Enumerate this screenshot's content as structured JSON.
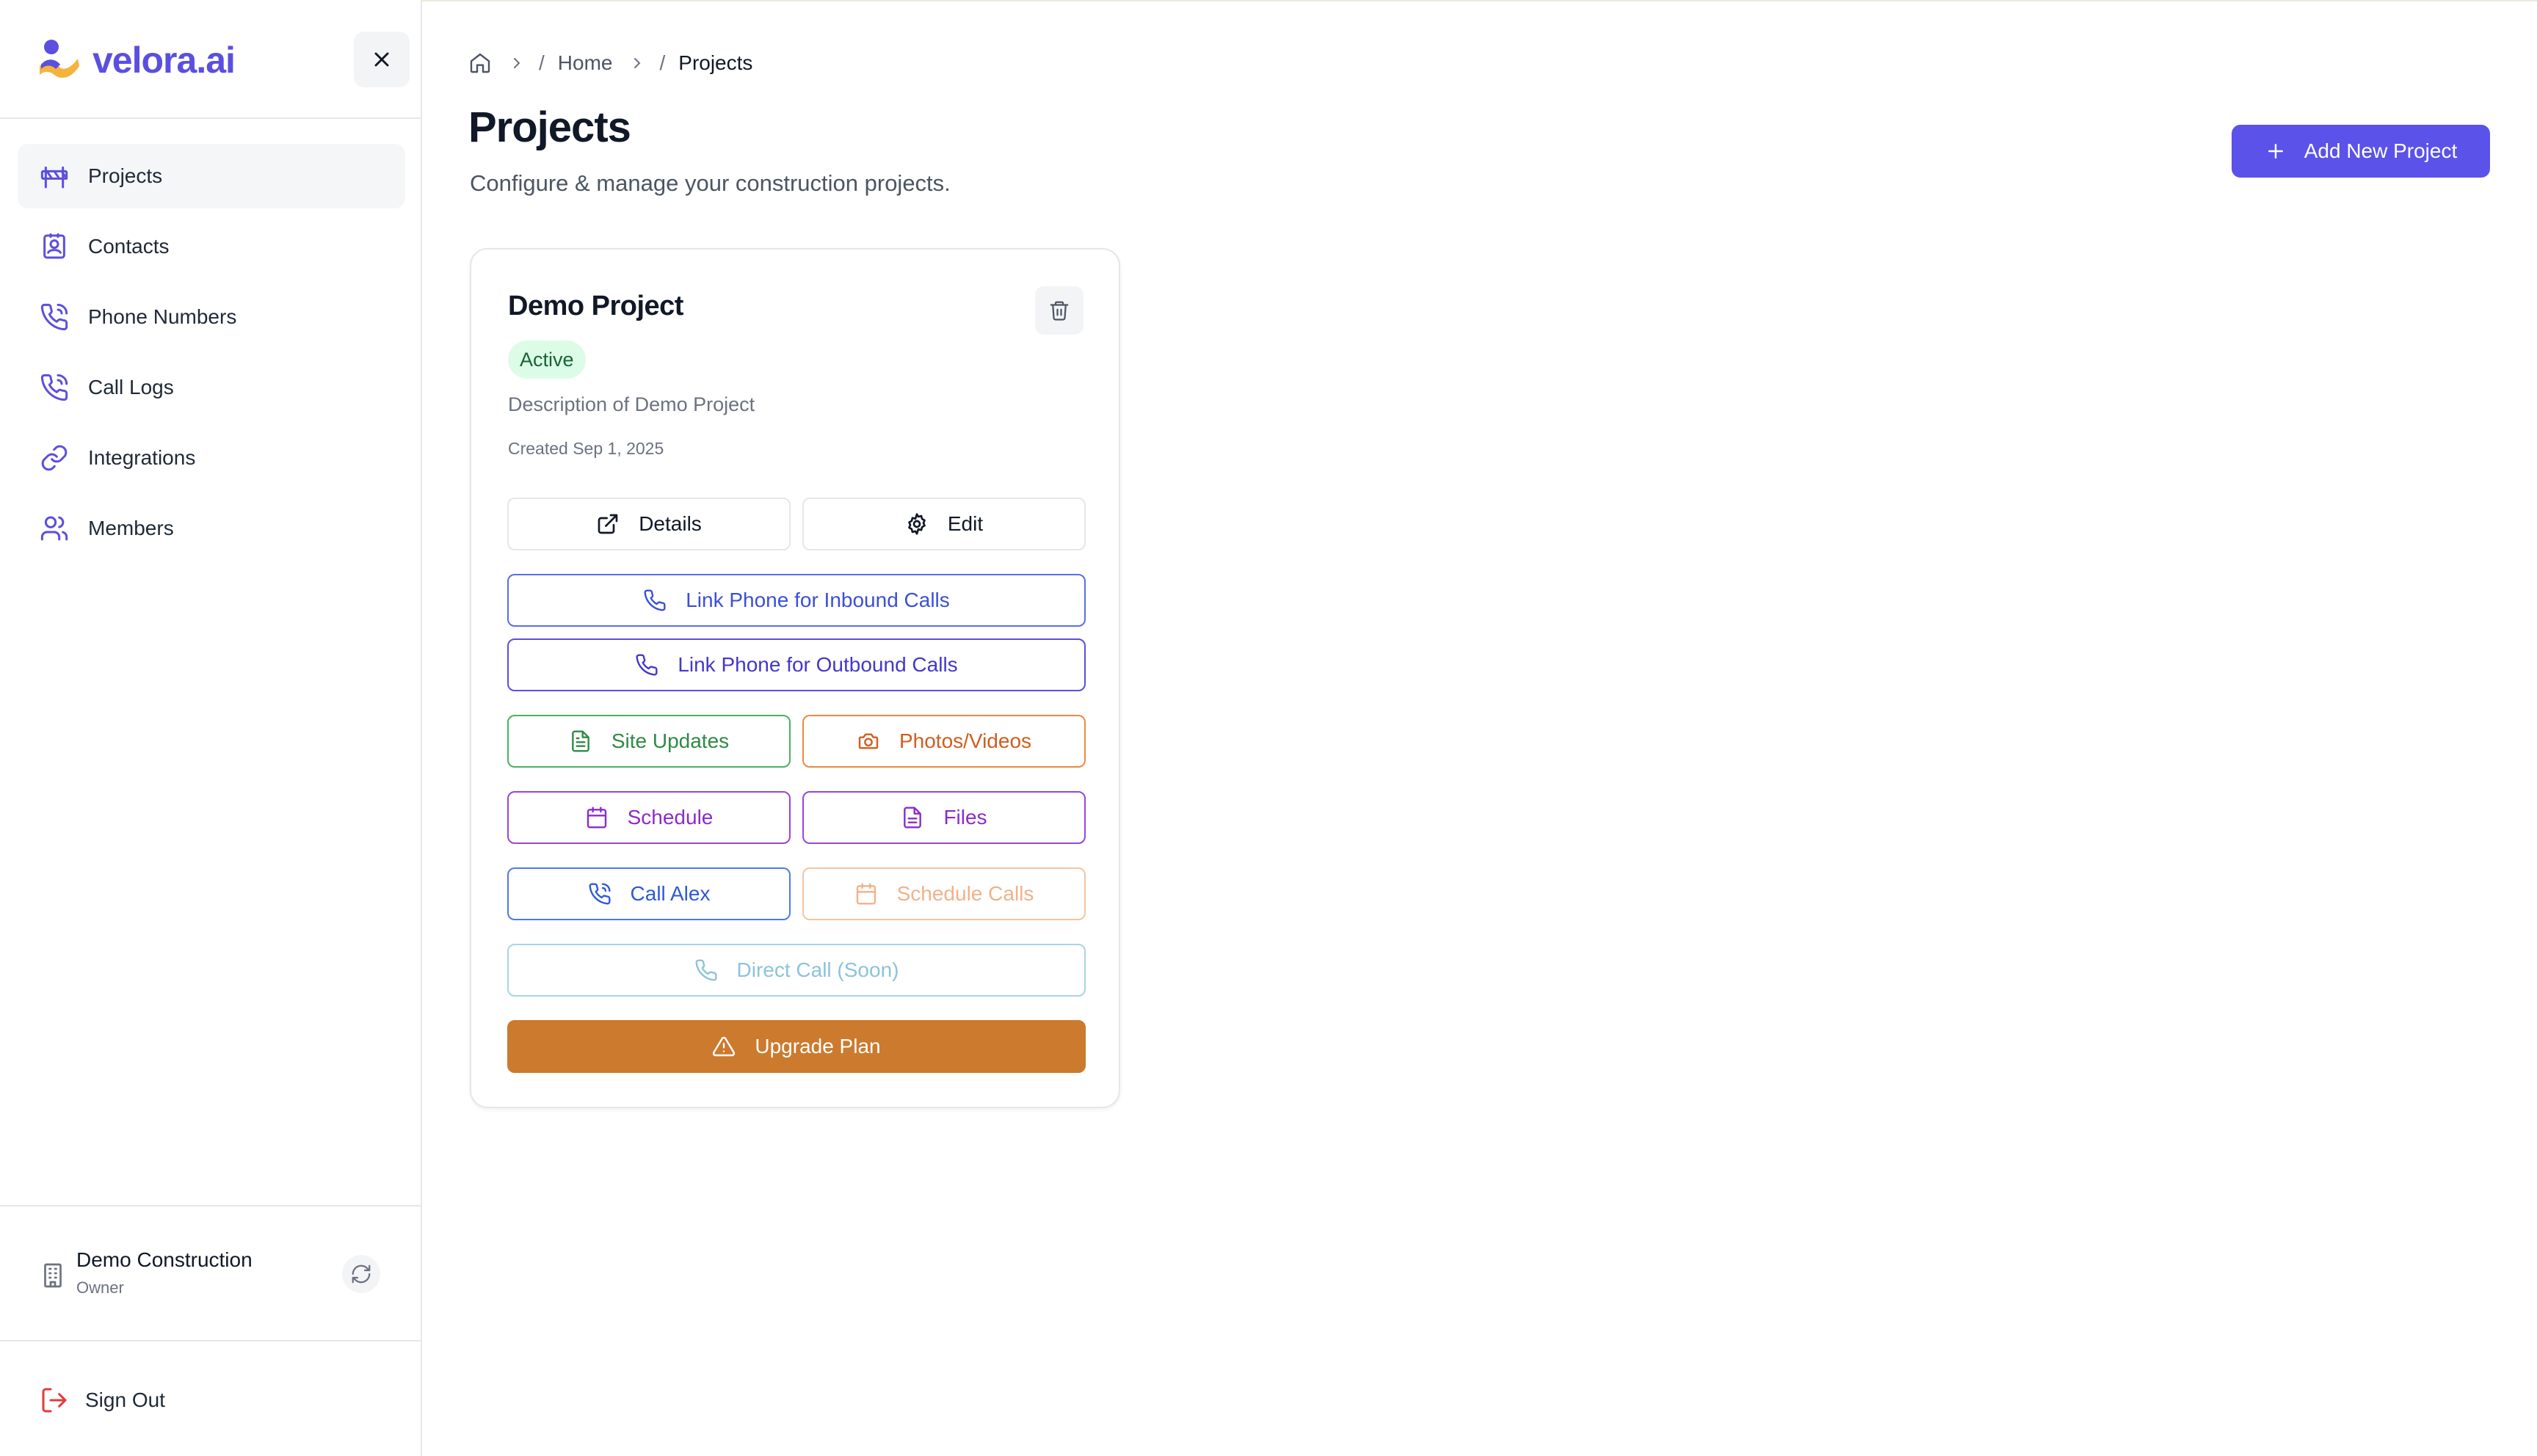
{
  "app": {
    "brand": "velora.ai"
  },
  "sidebar": {
    "items": [
      {
        "label": "Projects",
        "icon": "projects-icon",
        "active": true
      },
      {
        "label": "Contacts",
        "icon": "contacts-icon",
        "active": false
      },
      {
        "label": "Phone Numbers",
        "icon": "phone-numbers-icon",
        "active": false
      },
      {
        "label": "Call Logs",
        "icon": "call-logs-icon",
        "active": false
      },
      {
        "label": "Integrations",
        "icon": "link-icon",
        "active": false
      },
      {
        "label": "Members",
        "icon": "members-icon",
        "active": false
      }
    ],
    "organization": {
      "name": "Demo Construction",
      "role": "Owner"
    },
    "sign_out_label": "Sign Out"
  },
  "breadcrumb": {
    "home_label": "Home",
    "current": "Projects"
  },
  "page": {
    "title": "Projects",
    "subtitle": "Configure & manage your construction projects.",
    "add_button_label": "Add New Project"
  },
  "project_card": {
    "title": "Demo Project",
    "status": "Active",
    "description": "Description of Demo Project",
    "created": "Created Sep 1, 2025",
    "buttons": {
      "details": "Details",
      "edit": "Edit",
      "link_inbound": "Link Phone for Inbound Calls",
      "link_outbound": "Link Phone for Outbound Calls",
      "site_updates": "Site Updates",
      "photos_videos": "Photos/Videos",
      "schedule": "Schedule",
      "files": "Files",
      "call_alex": "Call Alex",
      "schedule_calls": "Schedule Calls",
      "direct_call": "Direct Call (Soon)",
      "upgrade_plan": "Upgrade Plan"
    }
  },
  "colors": {
    "brand": "#5b4fe0",
    "primary_button": "#5b52ea",
    "active_badge_bg": "#dcfce7",
    "upgrade": "#cc7a2e",
    "sign_out_icon": "#e23b3b"
  }
}
